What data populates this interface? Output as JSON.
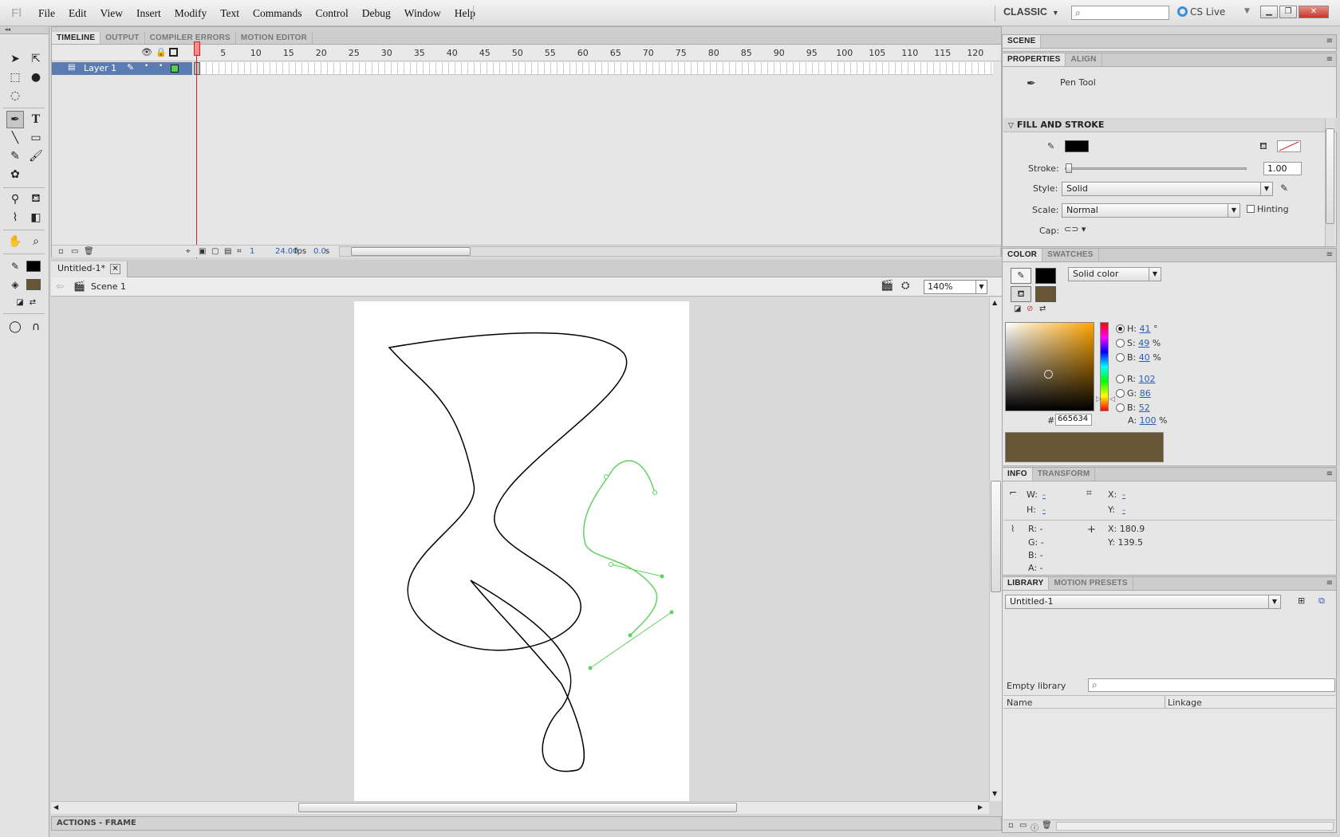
{
  "app": {
    "logo": "Fl"
  },
  "menu": [
    "File",
    "Edit",
    "View",
    "Insert",
    "Modify",
    "Text",
    "Commands",
    "Control",
    "Debug",
    "Window",
    "Help"
  ],
  "workspace": {
    "label": "CLASSIC"
  },
  "search": {
    "placeholder": ""
  },
  "cslive": {
    "label": "CS Live"
  },
  "timeline": {
    "tabs": [
      "TIMELINE",
      "OUTPUT",
      "COMPILER ERRORS",
      "MOTION EDITOR"
    ],
    "ruler": [
      "5",
      "10",
      "15",
      "20",
      "25",
      "30",
      "35",
      "40",
      "45",
      "50",
      "55",
      "60",
      "65",
      "70",
      "75",
      "80",
      "85",
      "90",
      "95",
      "100",
      "105",
      "110",
      "115",
      "120"
    ],
    "layer_name": "Layer 1",
    "current_frame": "1",
    "fps": "24.00",
    "fps_unit": "fps",
    "time": "0.0",
    "time_unit": "s"
  },
  "document": {
    "tab_title": "Untitled-1*",
    "scene": "Scene 1",
    "zoom": "140%"
  },
  "actions_bar": "ACTIONS - FRAME",
  "scene_panel": {
    "title": "SCENE"
  },
  "properties": {
    "tabs": [
      "PROPERTIES",
      "ALIGN"
    ],
    "tool_name": "Pen Tool",
    "section": "FILL AND STROKE",
    "stroke_label": "Stroke:",
    "stroke_value": "1.00",
    "style_label": "Style:",
    "style_value": "Solid",
    "scale_label": "Scale:",
    "scale_value": "Normal",
    "hinting_label": "Hinting",
    "cap_label": "Cap:",
    "stroke_color": "#000000",
    "stroke_fraction": 0.0
  },
  "color": {
    "tabs": [
      "COLOR",
      "SWATCHES"
    ],
    "type": "Solid color",
    "h_label": "H:",
    "h": "41",
    "h_unit": "°",
    "s_label": "S:",
    "s": "49",
    "s_unit": "%",
    "b_label": "B:",
    "b": "40",
    "b_unit": "%",
    "r_label": "R:",
    "r": "102",
    "g_label": "G:",
    "g": "86",
    "bl_label": "B:",
    "bl": "52",
    "hex_label": "#",
    "hex": "665634",
    "a_label": "A:",
    "a": "100",
    "a_unit": "%",
    "fill_color": "#665634",
    "stroke_color": "#000000"
  },
  "info": {
    "tabs": [
      "INFO",
      "TRANSFORM"
    ],
    "w_label": "W:",
    "w": "-",
    "h_label": "H:",
    "h": "-",
    "x_label": "X:",
    "x": "-",
    "y_label": "Y:",
    "y": "-",
    "r_label": "R:",
    "r": "-",
    "g_label": "G:",
    "g": "-",
    "b_label": "B:",
    "b": "-",
    "a_label": "A:",
    "a": "-",
    "cursor_x_label": "X:",
    "cursor_x": "180.9",
    "cursor_y_label": "Y:",
    "cursor_y": "139.5"
  },
  "library": {
    "tabs": [
      "LIBRARY",
      "MOTION PRESETS"
    ],
    "document": "Untitled-1",
    "empty_label": "Empty library",
    "col_name": "Name",
    "col_linkage": "Linkage"
  }
}
